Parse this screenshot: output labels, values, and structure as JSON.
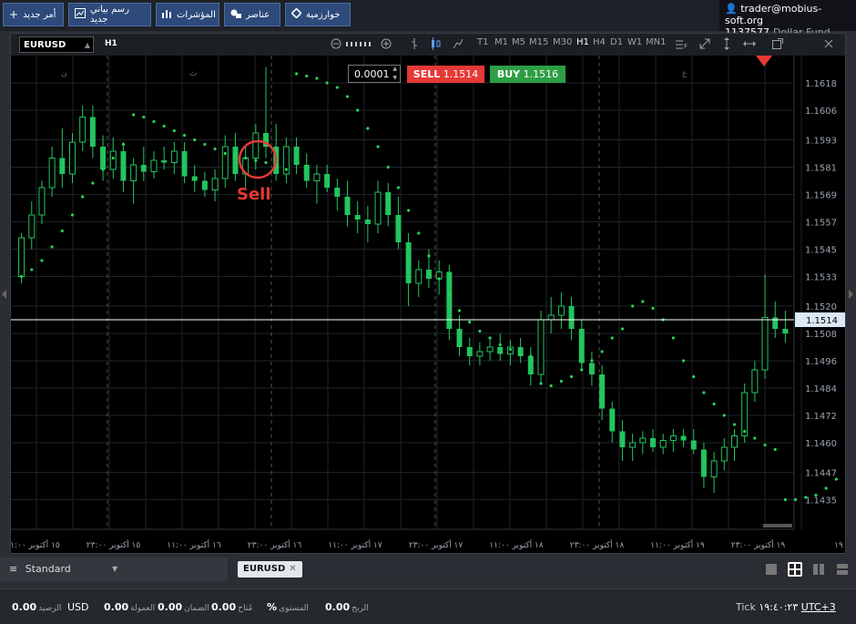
{
  "topbar": {
    "buttons": [
      {
        "label": "أمر جديد",
        "icon": "plus-icon"
      },
      {
        "label": "رسم بياني جديد",
        "icon": "chart-icon"
      },
      {
        "label": "المؤشرات",
        "icon": "bars-icon"
      },
      {
        "label": "عناصر",
        "icon": "shapes-icon"
      },
      {
        "label": "خوارزمية",
        "icon": "diamond-icon"
      }
    ],
    "account_email": "trader@mobius-soft.org",
    "account_balance": "1137577",
    "account_fund": "Dollar Fund"
  },
  "chart_toolbar": {
    "symbol": "EURUSD",
    "timeframe": "H1",
    "timeframes": [
      "T1",
      "M1",
      "M5",
      "M15",
      "M30",
      "H1",
      "H4",
      "D1",
      "W1",
      "MN1"
    ],
    "active_timeframe": "H1"
  },
  "trade_panel": {
    "lot": "0.0001",
    "sell_label": "SELL",
    "sell_price": "1.1514",
    "buy_label": "BUY",
    "buy_price": "1.1516"
  },
  "annotation": {
    "text": "Sell"
  },
  "chart_data": {
    "type": "candlestick",
    "symbol": "EURUSD",
    "timeframe": "H1",
    "y_ticks": [
      "1.1618",
      "1.1606",
      "1.1593",
      "1.1581",
      "1.1569",
      "1.1557",
      "1.1545",
      "1.1533",
      "1.1520",
      "1.1508",
      "1.1496",
      "1.1484",
      "1.1472",
      "1.1460",
      "1.1447",
      "1.1435"
    ],
    "ylim": [
      1.1422,
      1.163
    ],
    "current_price": "1.1514",
    "x_ticks": [
      "١٥ أكتوبر ١١:٠٠",
      "١٥ أكتوبر ٢٣:٠٠",
      "١٦ أكتوبر ١١:٠٠",
      "١٦ أكتوبر ٢٣:٠٠",
      "١٧ أكتوبر ١١:٠٠",
      "١٧ أكتوبر ٢٣:٠٠",
      "١٨ أكتوبر ١١:٠٠",
      "١٨ أكتوبر ٢٣:٠٠",
      "١٩ أكتوبر ١١:٠٠",
      "١٩ أكتوبر ٢٣:٠٠",
      "١٩"
    ],
    "day_labels": [
      "ن",
      "ث",
      "ع"
    ],
    "candles": [
      [
        1.1533,
        1.1552,
        1.153,
        1.155
      ],
      [
        1.155,
        1.1566,
        1.1545,
        1.156
      ],
      [
        1.156,
        1.1575,
        1.1556,
        1.1572
      ],
      [
        1.1572,
        1.159,
        1.1568,
        1.1585
      ],
      [
        1.1585,
        1.1598,
        1.1572,
        1.1578
      ],
      [
        1.1578,
        1.1596,
        1.1574,
        1.1592
      ],
      [
        1.1592,
        1.1608,
        1.1588,
        1.1603
      ],
      [
        1.1603,
        1.1608,
        1.1585,
        1.159
      ],
      [
        1.159,
        1.1595,
        1.1575,
        1.158
      ],
      [
        1.158,
        1.1594,
        1.1576,
        1.1588
      ],
      [
        1.1588,
        1.1592,
        1.157,
        1.1575
      ],
      [
        1.1575,
        1.1585,
        1.1565,
        1.1582
      ],
      [
        1.1582,
        1.159,
        1.1575,
        1.1579
      ],
      [
        1.1579,
        1.1588,
        1.1576,
        1.1584
      ],
      [
        1.1584,
        1.159,
        1.158,
        1.1583
      ],
      [
        1.1583,
        1.1592,
        1.1578,
        1.1588
      ],
      [
        1.1588,
        1.1592,
        1.1574,
        1.1577
      ],
      [
        1.1577,
        1.1582,
        1.157,
        1.1575
      ],
      [
        1.1575,
        1.1579,
        1.1568,
        1.1571
      ],
      [
        1.1571,
        1.158,
        1.1566,
        1.1576
      ],
      [
        1.1576,
        1.1595,
        1.1572,
        1.159
      ],
      [
        1.159,
        1.1596,
        1.1575,
        1.1578
      ],
      [
        1.1578,
        1.159,
        1.1572,
        1.1585
      ],
      [
        1.1585,
        1.16,
        1.158,
        1.1596
      ],
      [
        1.1596,
        1.1625,
        1.1585,
        1.159
      ],
      [
        1.159,
        1.16,
        1.1575,
        1.1578
      ],
      [
        1.1578,
        1.1594,
        1.1574,
        1.159
      ],
      [
        1.159,
        1.1594,
        1.1578,
        1.1582
      ],
      [
        1.1582,
        1.1587,
        1.1572,
        1.1575
      ],
      [
        1.1575,
        1.1582,
        1.1565,
        1.1578
      ],
      [
        1.1578,
        1.1582,
        1.157,
        1.1572
      ],
      [
        1.1572,
        1.1576,
        1.1562,
        1.1568
      ],
      [
        1.1568,
        1.1575,
        1.1555,
        1.156
      ],
      [
        1.156,
        1.1566,
        1.1552,
        1.1558
      ],
      [
        1.1558,
        1.1564,
        1.1548,
        1.1556
      ],
      [
        1.1556,
        1.1575,
        1.1552,
        1.157
      ],
      [
        1.157,
        1.1574,
        1.1555,
        1.156
      ],
      [
        1.156,
        1.1568,
        1.1545,
        1.1548
      ],
      [
        1.1548,
        1.1552,
        1.152,
        1.153
      ],
      [
        1.153,
        1.154,
        1.1524,
        1.1536
      ],
      [
        1.1536,
        1.1545,
        1.1528,
        1.1532
      ],
      [
        1.1532,
        1.154,
        1.1525,
        1.1535
      ],
      [
        1.1535,
        1.1538,
        1.1505,
        1.151
      ],
      [
        1.151,
        1.1516,
        1.1498,
        1.1502
      ],
      [
        1.1502,
        1.1506,
        1.1494,
        1.1498
      ],
      [
        1.1498,
        1.1504,
        1.1494,
        1.15
      ],
      [
        1.15,
        1.1506,
        1.1496,
        1.1502
      ],
      [
        1.1502,
        1.1508,
        1.1496,
        1.1499
      ],
      [
        1.1499,
        1.1505,
        1.1494,
        1.1502
      ],
      [
        1.1502,
        1.1506,
        1.1495,
        1.1498
      ],
      [
        1.1498,
        1.1502,
        1.1485,
        1.149
      ],
      [
        1.149,
        1.1518,
        1.1486,
        1.1514
      ],
      [
        1.1514,
        1.1524,
        1.1508,
        1.1516
      ],
      [
        1.1516,
        1.1526,
        1.151,
        1.152
      ],
      [
        1.152,
        1.1524,
        1.1505,
        1.151
      ],
      [
        1.151,
        1.1514,
        1.1492,
        1.1495
      ],
      [
        1.1495,
        1.15,
        1.1485,
        1.149
      ],
      [
        1.149,
        1.1494,
        1.147,
        1.1475
      ],
      [
        1.1475,
        1.1478,
        1.146,
        1.1465
      ],
      [
        1.1465,
        1.147,
        1.1452,
        1.1458
      ],
      [
        1.1458,
        1.1464,
        1.1452,
        1.146
      ],
      [
        1.146,
        1.1465,
        1.1455,
        1.1462
      ],
      [
        1.1462,
        1.1466,
        1.1456,
        1.1458
      ],
      [
        1.1458,
        1.1464,
        1.1455,
        1.1461
      ],
      [
        1.1461,
        1.1466,
        1.1456,
        1.1463
      ],
      [
        1.1463,
        1.1466,
        1.1458,
        1.1461
      ],
      [
        1.1461,
        1.1466,
        1.1455,
        1.1457
      ],
      [
        1.1457,
        1.146,
        1.144,
        1.1445
      ],
      [
        1.1445,
        1.1456,
        1.1438,
        1.1452
      ],
      [
        1.1452,
        1.1462,
        1.1448,
        1.1458
      ],
      [
        1.1458,
        1.1466,
        1.1452,
        1.1463
      ],
      [
        1.1463,
        1.1486,
        1.146,
        1.1482
      ],
      [
        1.1482,
        1.1496,
        1.1478,
        1.1492
      ],
      [
        1.1492,
        1.1534,
        1.1488,
        1.1515
      ],
      [
        1.1515,
        1.1522,
        1.1506,
        1.151
      ],
      [
        1.151,
        1.1518,
        1.1504,
        1.1508
      ]
    ],
    "sar": [
      1.1533,
      1.1536,
      1.154,
      1.1546,
      1.1553,
      1.156,
      1.1568,
      1.1574,
      1.158,
      1.1585,
      1.1591,
      1.1604,
      1.1603,
      1.1601,
      1.1599,
      1.1597,
      1.1595,
      1.1593,
      1.1591,
      1.1589,
      1.1587,
      1.1586,
      1.1585,
      1.1584,
      1.1583,
      1.1581,
      1.158,
      1.1622,
      1.1621,
      1.162,
      1.1618,
      1.1616,
      1.1612,
      1.1606,
      1.1598,
      1.159,
      1.1581,
      1.1572,
      1.1562,
      1.1552,
      1.1542,
      1.1532,
      1.1525,
      1.1518,
      1.1513,
      1.1509,
      1.1506,
      1.1503,
      1.1501,
      1.1499,
      1.1498,
      1.1486,
      1.1485,
      1.1487,
      1.1489,
      1.1492,
      1.1496,
      1.15,
      1.1506,
      1.151,
      1.152,
      1.1522,
      1.1519,
      1.1514,
      1.1506,
      1.1496,
      1.1489,
      1.1482,
      1.1477,
      1.1472,
      1.1468,
      1.1465,
      1.1462,
      1.1459,
      1.1457,
      1.1435,
      1.1435,
      1.1436,
      1.1437,
      1.144,
      1.1444,
      1.145,
      1.1458,
      1.147,
      1.1484,
      1.1497
    ]
  },
  "bottom_tabs": {
    "profile": "Standard",
    "open_tab": "EURUSD"
  },
  "statusbar": {
    "balance_value": "0.00",
    "balance_label": "الرصيد",
    "balance_currency": "USD",
    "commission_value": "0.00",
    "commission_label": "العمولة",
    "margin_value": "0.00",
    "margin_label": "الضمان",
    "free_value": "0.00",
    "free_label": "مُتاح",
    "level_value": "%",
    "level_label": "المستوى",
    "profit_value": "0.00",
    "profit_label": "الربح",
    "tick_label": "Tick",
    "time": "١٩:٤٠:٢٣",
    "timezone": "UTC+3"
  },
  "colors": {
    "up": "#22c55e",
    "down": "#22c55e",
    "sar": "#27d15a",
    "sell": "#e53935",
    "buy": "#2e9e45",
    "annotation": "#e53935"
  }
}
